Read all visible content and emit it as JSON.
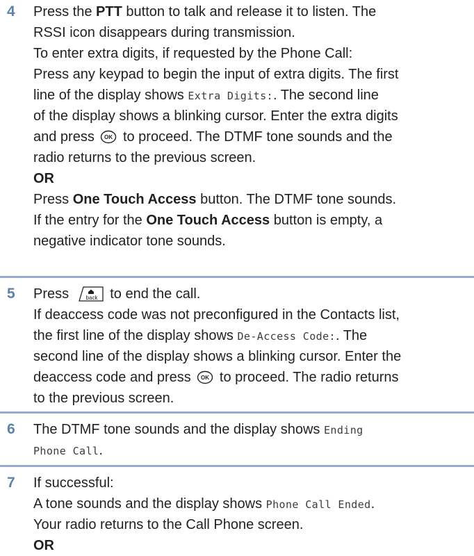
{
  "steps": [
    {
      "number": "4",
      "line1_pre": "Press the ",
      "line1_bold": "PTT",
      "line1_post": " button to talk and release it to listen. The",
      "line2": "RSSI icon disappears during transmission.",
      "line3": "To enter extra digits, if requested by the Phone Call:",
      "line4": "Press any keypad to begin the input of extra digits. The first",
      "line5_pre": "line of the display shows ",
      "line5_mono": "Extra Digits:",
      "line5_post": ". The second line",
      "line6": "of the display shows a blinking cursor. Enter the extra digits",
      "line7_pre": "and press ",
      "line7_post": " to proceed. The DTMF tone sounds and the",
      "line8": "radio returns to the previous screen.",
      "or": "OR",
      "line10_pre": "Press ",
      "line10_bold": "One Touch Access",
      "line10_post": " button. The DTMF tone sounds.",
      "line11_pre": "If the entry for the ",
      "line11_bold": "One Touch Access",
      "line11_post": " button is empty, a",
      "line12": "negative indicator tone sounds."
    },
    {
      "number": "5",
      "line1_pre": "Press ",
      "line1_post": " to end the call.",
      "line2": "If deaccess code was not preconfigured in the Contacts list,",
      "line3_pre": "the first line of the display shows ",
      "line3_mono": "De-Access Code:",
      "line3_post": ". The",
      "line4": "second line of the display shows a blinking cursor. Enter the",
      "line5_pre": "deaccess code and press ",
      "line5_post": " to proceed. The radio returns",
      "line6": "to the previous screen."
    },
    {
      "number": "6",
      "line1_pre": "The DTMF tone sounds and the display shows ",
      "line1_mono": "Ending",
      "line2_mono": "Phone Call",
      "line2_post": "."
    },
    {
      "number": "7",
      "line1": "If successful:",
      "line2_pre": "A tone sounds and the display shows ",
      "line2_mono": "Phone Call Ended",
      "line2_post": ".",
      "line3": "Your radio returns to the Call Phone screen.",
      "or": "OR"
    }
  ],
  "icons": {
    "ok_key": "ok-button-icon",
    "back_key": "back-button-icon",
    "back_key_label": "back"
  },
  "colors": {
    "step_number": "#5d83a9",
    "rule": "#93adc8",
    "text": "#231f20"
  }
}
